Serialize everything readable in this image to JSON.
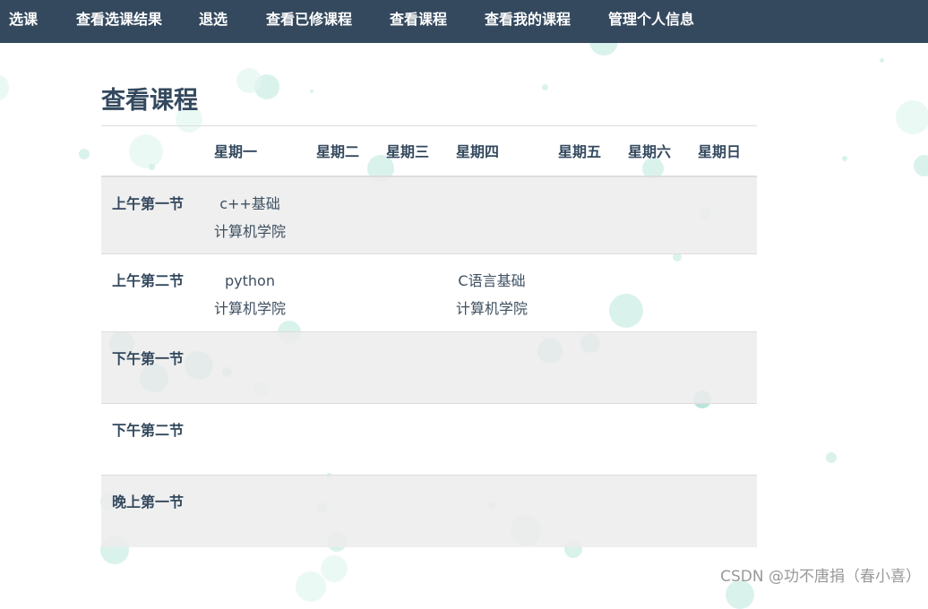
{
  "nav": {
    "items": [
      "选课",
      "查看选课结果",
      "退选",
      "查看已修课程",
      "查看课程",
      "查看我的课程",
      "管理个人信息"
    ]
  },
  "page": {
    "title": "查看课程"
  },
  "schedule": {
    "corner": "",
    "days": [
      "星期一",
      "星期二",
      "星期三",
      "星期四",
      "星期五",
      "星期六",
      "星期日"
    ],
    "rows": [
      {
        "label": "上午第一节",
        "cells": [
          {
            "course": "c++基础",
            "college": "计算机学院"
          },
          null,
          null,
          null,
          null,
          null,
          null
        ]
      },
      {
        "label": "上午第二节",
        "cells": [
          {
            "course": "python",
            "college": "计算机学院"
          },
          null,
          null,
          {
            "course": "C语言基础",
            "college": "计算机学院"
          },
          null,
          null,
          null
        ]
      },
      {
        "label": "下午第一节",
        "cells": [
          null,
          null,
          null,
          null,
          null,
          null,
          null
        ]
      },
      {
        "label": "下午第二节",
        "cells": [
          null,
          null,
          null,
          null,
          null,
          null,
          null
        ]
      },
      {
        "label": "晚上第一节",
        "cells": [
          null,
          null,
          null,
          null,
          null,
          null,
          null
        ]
      }
    ]
  },
  "watermark": "CSDN @功不唐捐（春小喜）",
  "colors": {
    "navbar": "#34495e",
    "text": "#34495e",
    "bubble": "#a9ded2",
    "row_shade": "#f0f0f0"
  }
}
